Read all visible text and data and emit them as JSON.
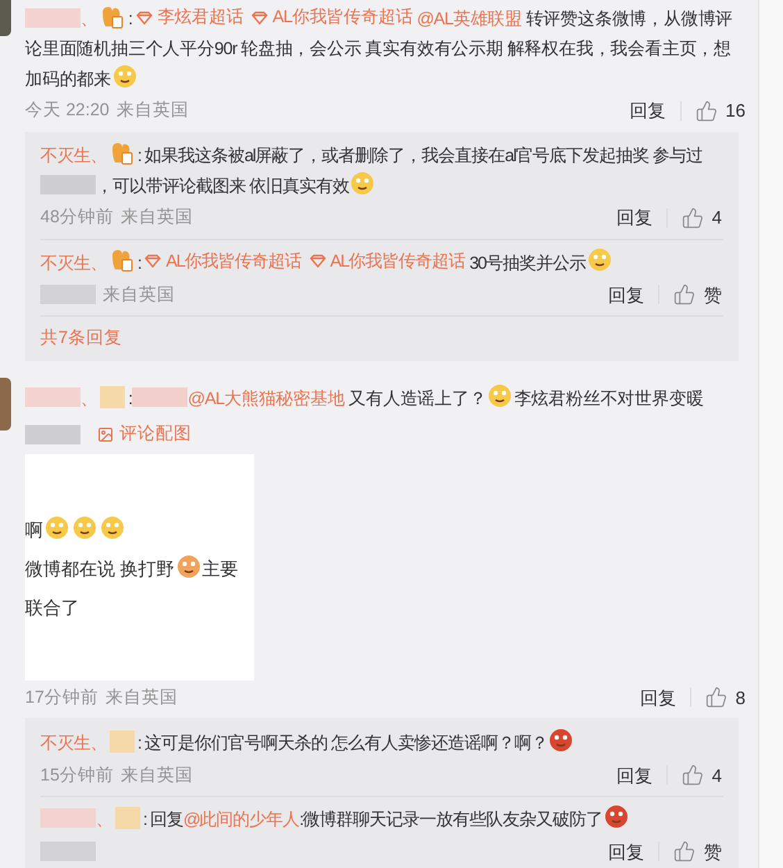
{
  "comments": [
    {
      "avatar": {
        "kind": "picture",
        "color": "#5a5a4e"
      },
      "content": [
        {
          "kind": "blur",
          "color": "#f3d3cf"
        },
        {
          "kind": "name",
          "text": "、"
        },
        {
          "kind": "badge"
        },
        {
          "kind": "text",
          "text": ":"
        },
        {
          "kind": "topic",
          "text": "李炫君超话"
        },
        {
          "kind": "topic",
          "text": "AL你我皆传奇超话"
        },
        {
          "kind": "link",
          "text": "@AL英雄联盟"
        },
        {
          "kind": "text",
          "text": " 转评赞这条微博，从微博评论里面随机抽三个人平分90r 轮盘抽，会公示 真实有效有公示期 解释权在我，我会看主页，想加码的都来"
        },
        {
          "kind": "emoji",
          "color": "#f7c948"
        }
      ],
      "footer": {
        "meta": [
          {
            "kind": "text",
            "text": "今天 22:20"
          },
          {
            "kind": "text",
            "text": "来自英国"
          }
        ],
        "reply": "回复",
        "likes": "16"
      },
      "replies": [
        {
          "content": [
            {
              "kind": "name",
              "text": "不灭生、"
            },
            {
              "kind": "badge"
            },
            {
              "kind": "text",
              "text": ": 如果我这条被al屏蔽了，或者删除了，我会直接在al官号底下发起抽奖 参与过 "
            },
            {
              "kind": "blur",
              "color": "#cfcfd1"
            },
            {
              "kind": "text",
              "text": "，可以带评论截图来 依旧真实有效"
            },
            {
              "kind": "emoji",
              "color": "#f7c948"
            }
          ],
          "footer": {
            "meta": [
              {
                "kind": "text",
                "text": "48分钟前"
              },
              {
                "kind": "text",
                "text": "来自英国"
              }
            ],
            "reply": "回复",
            "likes": "4"
          }
        },
        {
          "content": [
            {
              "kind": "name",
              "text": "不灭生、"
            },
            {
              "kind": "badge"
            },
            {
              "kind": "text",
              "text": ":"
            },
            {
              "kind": "topic",
              "text": "AL你我皆传奇超话"
            },
            {
              "kind": "topic",
              "text": "AL你我皆传奇超话"
            },
            {
              "kind": "text",
              "text": "30号抽奖并公示"
            },
            {
              "kind": "emoji",
              "color": "#f7c948"
            }
          ],
          "footer": {
            "meta": [
              {
                "kind": "blur",
                "color": "#d2d2d4"
              },
              {
                "kind": "text",
                "text": "来自英国"
              }
            ],
            "reply": "回复",
            "likes": "赞"
          }
        }
      ],
      "more_replies": "共7条回复"
    },
    {
      "avatar": {
        "kind": "picture",
        "color": "#8a6a4a"
      },
      "content": [
        {
          "kind": "blur",
          "color": "#f3d3cf"
        },
        {
          "kind": "name",
          "text": "、"
        },
        {
          "kind": "blurred_badge",
          "color": "#f5d9a8"
        },
        {
          "kind": "text",
          "text": ":"
        },
        {
          "kind": "blur",
          "color": "#f3cfcb"
        },
        {
          "kind": "link",
          "text": "@AL大熊猫秘密基地"
        },
        {
          "kind": "text",
          "text": " 又有人造谣上了？"
        },
        {
          "kind": "emoji",
          "color": "#f7c948"
        },
        {
          "kind": "text",
          "text": "李炫君粉丝不对世界变暖"
        }
      ],
      "attachments": [
        {
          "kind": "blur",
          "color": "#cfcfd1"
        },
        {
          "kind": "image_link",
          "text": "评论配图"
        }
      ],
      "image": {
        "lines": [
          [
            {
              "kind": "text",
              "text": "啊"
            },
            {
              "kind": "emoji",
              "color": "#f7c948"
            },
            {
              "kind": "emoji",
              "color": "#f7c948"
            },
            {
              "kind": "emoji",
              "color": "#f7c948"
            }
          ],
          [
            {
              "kind": "text",
              "text": "微博都在说 换打野"
            },
            {
              "kind": "emoji",
              "color": "#f2a35a"
            },
            {
              "kind": "text",
              "text": "主要"
            }
          ],
          [
            {
              "kind": "text",
              "text": "联合了"
            }
          ]
        ]
      },
      "footer": {
        "meta": [
          {
            "kind": "text",
            "text": "17分钟前"
          },
          {
            "kind": "text",
            "text": "来自英国"
          }
        ],
        "reply": "回复",
        "likes": "8"
      },
      "replies": [
        {
          "content": [
            {
              "kind": "name",
              "text": "不灭生、"
            },
            {
              "kind": "blurred_badge",
              "color": "#f5d9a8"
            },
            {
              "kind": "text",
              "text": ": 这可是你们官号啊天杀的 怎么有人卖惨还造谣啊？啊？"
            },
            {
              "kind": "emoji",
              "color": "#d9462f"
            }
          ],
          "footer": {
            "meta": [
              {
                "kind": "text",
                "text": "15分钟前"
              },
              {
                "kind": "text",
                "text": "来自英国"
              }
            ],
            "reply": "回复",
            "likes": "4"
          }
        },
        {
          "content": [
            {
              "kind": "blur",
              "color": "#f3d3cf"
            },
            {
              "kind": "name",
              "text": "、"
            },
            {
              "kind": "blurred_badge",
              "color": "#f5d9a8"
            },
            {
              "kind": "text",
              "text": ": 回复"
            },
            {
              "kind": "link",
              "text": "@此间的少年人"
            },
            {
              "kind": "text",
              "text": ":微博群聊天记录一放有些队友杂又破防了"
            },
            {
              "kind": "emoji",
              "color": "#d9462f"
            }
          ],
          "footer": {
            "meta": [
              {
                "kind": "blur",
                "color": "#d2d2d4"
              }
            ],
            "reply": "回复",
            "likes": "赞"
          }
        }
      ]
    }
  ]
}
